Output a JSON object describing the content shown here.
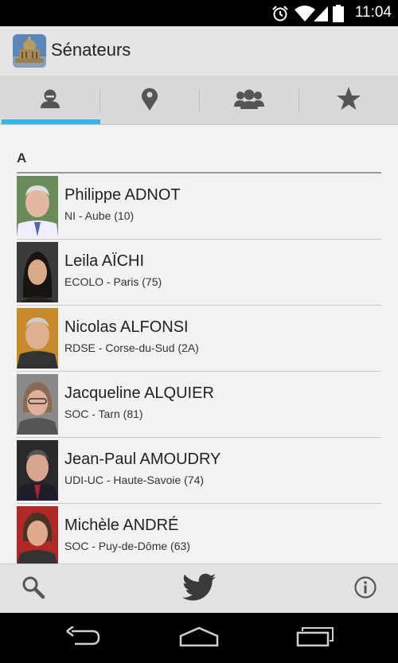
{
  "status_bar": {
    "time": "11:04",
    "icons": [
      "alarm-icon",
      "wifi-icon",
      "signal-icon",
      "battery-icon"
    ]
  },
  "app": {
    "title": "Sénateurs",
    "icon": "senate-building-icon"
  },
  "tabs": [
    {
      "icon": "person-icon",
      "selected": true
    },
    {
      "icon": "location-pin-icon",
      "selected": false
    },
    {
      "icon": "group-icon",
      "selected": false
    },
    {
      "icon": "star-icon",
      "selected": false
    }
  ],
  "colors": {
    "accent": "#33b5e5",
    "tab_icon": "#555555",
    "twitter_icon": "#3a3a3a"
  },
  "list": {
    "section": "A",
    "senators": [
      {
        "name": "Philippe ADNOT",
        "detail": "NI - Aube (10)"
      },
      {
        "name": "Leila AÏCHI",
        "detail": "ECOLO - Paris (75)"
      },
      {
        "name": "Nicolas ALFONSI",
        "detail": "RDSE - Corse-du-Sud (2A)"
      },
      {
        "name": "Jacqueline ALQUIER",
        "detail": "SOC - Tarn (81)"
      },
      {
        "name": "Jean-Paul AMOUDRY",
        "detail": "UDI-UC - Haute-Savoie (74)"
      },
      {
        "name": "Michèle ANDRÉ",
        "detail": "SOC - Puy-de-Dôme (63)"
      }
    ]
  },
  "bottom_bar": {
    "buttons": [
      "search-icon",
      "twitter-icon",
      "info-icon"
    ]
  },
  "nav_bar": {
    "buttons": [
      "back-icon",
      "home-icon",
      "recent-apps-icon"
    ]
  }
}
